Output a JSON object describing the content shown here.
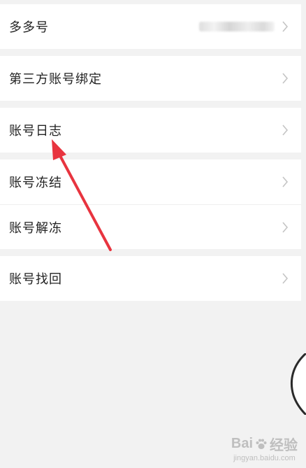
{
  "groups": [
    {
      "items": [
        {
          "label": "多多号"
        }
      ]
    },
    {
      "items": [
        {
          "label": "第三方账号绑定"
        }
      ]
    },
    {
      "items": [
        {
          "label": "账号日志"
        }
      ]
    },
    {
      "items": [
        {
          "label": "账号冻结"
        },
        {
          "label": "账号解冻"
        }
      ]
    },
    {
      "items": [
        {
          "label": "账号找回"
        }
      ]
    }
  ],
  "icons": {
    "chevron": "chevron-right-icon",
    "annotation": "red-arrow-icon",
    "watermark_logo": "paw-icon"
  },
  "watermark": {
    "brand": "Bai",
    "brand_suffix": "经验",
    "sub": "jingyan.baidu.com"
  },
  "colors": {
    "background": "#f2f2f2",
    "row": "#ffffff",
    "text": "#222222",
    "chevron": "#c4c4c4",
    "annotation": "#e8343f"
  }
}
